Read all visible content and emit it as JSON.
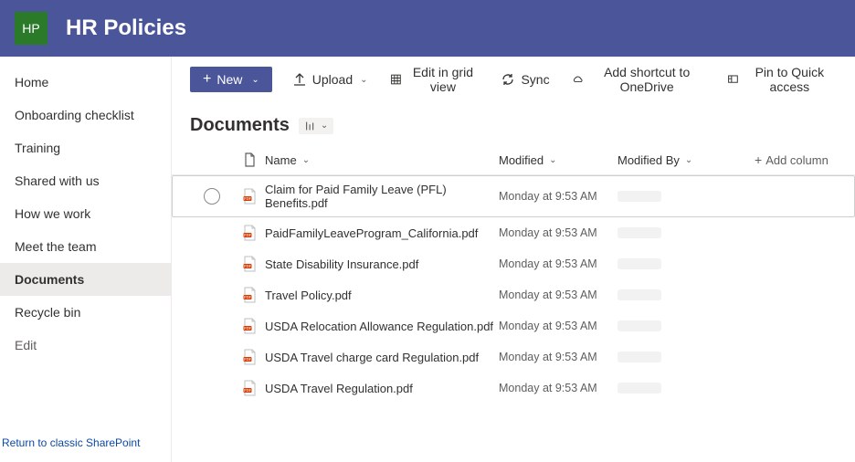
{
  "site": {
    "logo_initials": "HP",
    "title": "HR Policies"
  },
  "sidebar": {
    "items": [
      {
        "label": "Home"
      },
      {
        "label": "Onboarding checklist"
      },
      {
        "label": "Training"
      },
      {
        "label": "Shared with us"
      },
      {
        "label": "How we work"
      },
      {
        "label": "Meet the team"
      },
      {
        "label": "Documents"
      },
      {
        "label": "Recycle bin"
      }
    ],
    "edit_label": "Edit",
    "return_link": "Return to classic SharePoint"
  },
  "toolbar": {
    "new_label": "New",
    "upload_label": "Upload",
    "grid_label": "Edit in grid view",
    "sync_label": "Sync",
    "shortcut_label": "Add shortcut to OneDrive",
    "pin_label": "Pin to Quick access"
  },
  "page": {
    "title": "Documents"
  },
  "columns": {
    "name": "Name",
    "modified": "Modified",
    "modified_by": "Modified By",
    "add_column": "Add column"
  },
  "files": [
    {
      "name": "Claim for Paid Family Leave (PFL) Benefits.pdf",
      "modified": "Monday at 9:53 AM"
    },
    {
      "name": "PaidFamilyLeaveProgram_California.pdf",
      "modified": "Monday at 9:53 AM"
    },
    {
      "name": "State Disability Insurance.pdf",
      "modified": "Monday at 9:53 AM"
    },
    {
      "name": "Travel Policy.pdf",
      "modified": "Monday at 9:53 AM"
    },
    {
      "name": "USDA Relocation Allowance Regulation.pdf",
      "modified": "Monday at 9:53 AM"
    },
    {
      "name": "USDA Travel charge card Regulation.pdf",
      "modified": "Monday at 9:53 AM"
    },
    {
      "name": "USDA Travel Regulation.pdf",
      "modified": "Monday at 9:53 AM"
    }
  ]
}
